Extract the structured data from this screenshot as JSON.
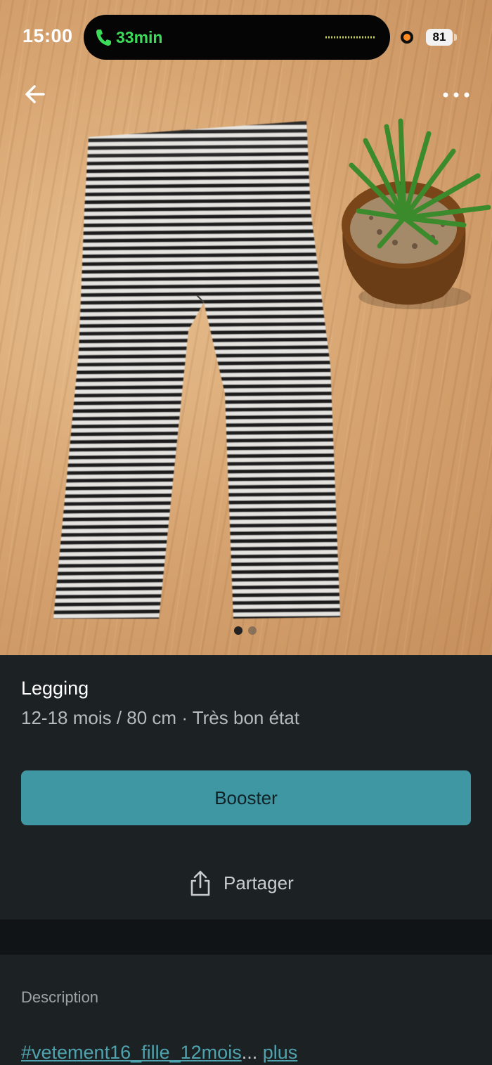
{
  "status_bar": {
    "time": "15:00",
    "call_duration": "33min",
    "battery": "81"
  },
  "gallery": {
    "page_count": 2,
    "current_page": 1
  },
  "item": {
    "title": "Legging",
    "details": "12-18 mois / 80 cm · Très bon état"
  },
  "actions": {
    "boost_label": "Booster",
    "share_label": "Partager"
  },
  "description": {
    "label": "Description",
    "hashtag": "#vetement16_fille_12mois",
    "ellipsis": "...",
    "more_label": "plus"
  },
  "colors": {
    "accent": "#4097a4",
    "background": "#1c2124",
    "call_green": "#3cdc5a",
    "link": "#4fa3ae"
  },
  "icons": [
    "back-arrow-icon",
    "more-icon",
    "phone-icon",
    "share-icon"
  ]
}
